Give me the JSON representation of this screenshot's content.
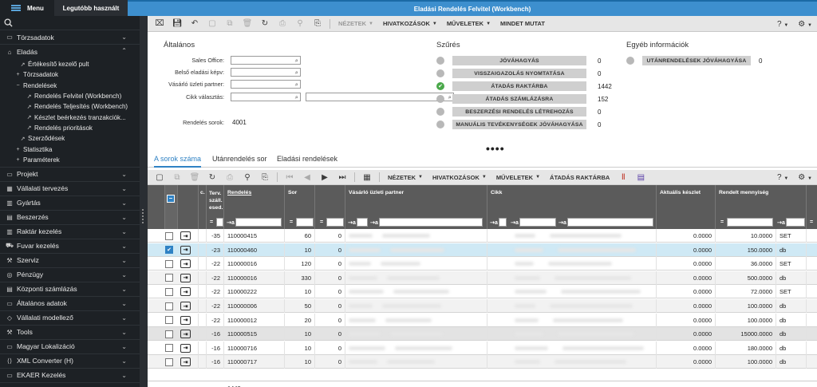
{
  "topbar": {
    "menu_label": "Menu",
    "recent_label": "Legutóbb használt",
    "active_tab": "Eladási Rendelés Felvitel (Workbench)"
  },
  "sidebar": {
    "sections_top": [
      {
        "label": "Törzsadatok",
        "icon": "folder-icon"
      }
    ],
    "eladas": {
      "label": "Eladás",
      "items": [
        "Értékesítő kezelő pult",
        "Törzsadatok",
        "Rendelések",
        "Rendelés Felvitel (Workbench)",
        "Rendelés Teljesítés (Workbench)",
        "Készlet beérkezés tranzakciók...",
        "Rendelés prioritások",
        "Szerződések",
        "Statisztika",
        "Paraméterek"
      ]
    },
    "sections": [
      "Projekt",
      "Vállalati tervezés",
      "Gyártás",
      "Beszerzés",
      "Raktár kezelés",
      "Fuvar kezelés",
      "Szerviz",
      "Pénzügy",
      "Központi számlázás",
      "Általános adatok",
      "Vállalati modellező",
      "Tools",
      "Magyar Lokalizáció",
      "XML Converter (H)",
      "EKAER Kezelés"
    ]
  },
  "toolbar1": {
    "nezetek": "NÉZETEK",
    "hivatkozasok": "HIVATKOZÁSOK",
    "muveletek": "MŰVELETEK",
    "mindet": "MINDET MUTAT",
    "help": "?"
  },
  "general": {
    "title": "Általános",
    "fields": [
      "Sales Office:",
      "Belső eladási képv:",
      "Vásárló üzleti partner:",
      "Cikk választás:"
    ],
    "orders_label": "Rendelés sorok:",
    "orders_value": "4001"
  },
  "filters": {
    "title": "Szűrés",
    "items": [
      {
        "label": "JÓVÁHAGYÁS",
        "count": "0"
      },
      {
        "label": "VISSZAIGAZOLÁS NYOMTATÁSA",
        "count": "0"
      },
      {
        "label": "ÁTADÁS RAKTÁRBA",
        "count": "1442"
      },
      {
        "label": "ÁTADÁS SZÁMLÁZÁSRA",
        "count": "152"
      },
      {
        "label": "BESZERZÉSI RENDELÉS LÉTREHOZÁS",
        "count": "0"
      },
      {
        "label": "MANUÁLIS TEVÉKENYSÉGEK JÓVÁHAGYÁSA",
        "count": "0"
      }
    ]
  },
  "other": {
    "title": "Egyéb információk",
    "label": "UTÁNRENDELÉSEK JÓVÁHAGYÁSA",
    "count": "0"
  },
  "tabs": [
    "A sorok száma",
    "Utánrendelés sor",
    "Eladási rendelések"
  ],
  "toolbar2": {
    "nezetek": "NÉZETEK",
    "hivatkozasok": "HIVATKOZÁSOK",
    "muveletek": "MŰVELETEK",
    "atadas": "ÁTADÁS RAKTÁRBA",
    "help": "?"
  },
  "grid": {
    "headers": {
      "c": "c.",
      "terv": "Terv. száll. esed.",
      "rendeles": "Rendelés",
      "sor": "Sor",
      "partner": "Vásárló üzleti partner",
      "cikk": "Cikk",
      "aktualis": "Aktuális készlet",
      "rendelt": "Rendelt mennyiség"
    },
    "filter_eq": "=",
    "filter_a": "⇢a",
    "rows": [
      {
        "terv": "-35",
        "rendeles": "110000415",
        "sor": "60",
        "z": "0",
        "aktualis": "0.0000",
        "rendelt": "10.0000",
        "unit": "SET"
      },
      {
        "terv": "-23",
        "rendeles": "110000460",
        "sor": "10",
        "z": "0",
        "aktualis": "0.0000",
        "rendelt": "150.0000",
        "unit": "db"
      },
      {
        "terv": "-22",
        "rendeles": "110000016",
        "sor": "120",
        "z": "0",
        "aktualis": "0.0000",
        "rendelt": "36.0000",
        "unit": "SET"
      },
      {
        "terv": "-22",
        "rendeles": "110000016",
        "sor": "330",
        "z": "0",
        "aktualis": "0.0000",
        "rendelt": "500.0000",
        "unit": "db"
      },
      {
        "terv": "-22",
        "rendeles": "110000222",
        "sor": "10",
        "z": "0",
        "aktualis": "0.0000",
        "rendelt": "72.0000",
        "unit": "SET"
      },
      {
        "terv": "-22",
        "rendeles": "110000006",
        "sor": "50",
        "z": "0",
        "aktualis": "0.0000",
        "rendelt": "100.0000",
        "unit": "db"
      },
      {
        "terv": "-22",
        "rendeles": "110000012",
        "sor": "20",
        "z": "0",
        "aktualis": "0.0000",
        "rendelt": "100.0000",
        "unit": "db"
      },
      {
        "terv": "-16",
        "rendeles": "110000515",
        "sor": "10",
        "z": "0",
        "aktualis": "0.0000",
        "rendelt": "15000.0000",
        "unit": "db"
      },
      {
        "terv": "-16",
        "rendeles": "110000716",
        "sor": "10",
        "z": "0",
        "aktualis": "0.0000",
        "rendelt": "180.0000",
        "unit": "db"
      },
      {
        "terv": "-16",
        "rendeles": "110000717",
        "sor": "10",
        "z": "0",
        "aktualis": "0.0000",
        "rendelt": "100.0000",
        "unit": "db"
      }
    ],
    "footer_count": "1442"
  }
}
